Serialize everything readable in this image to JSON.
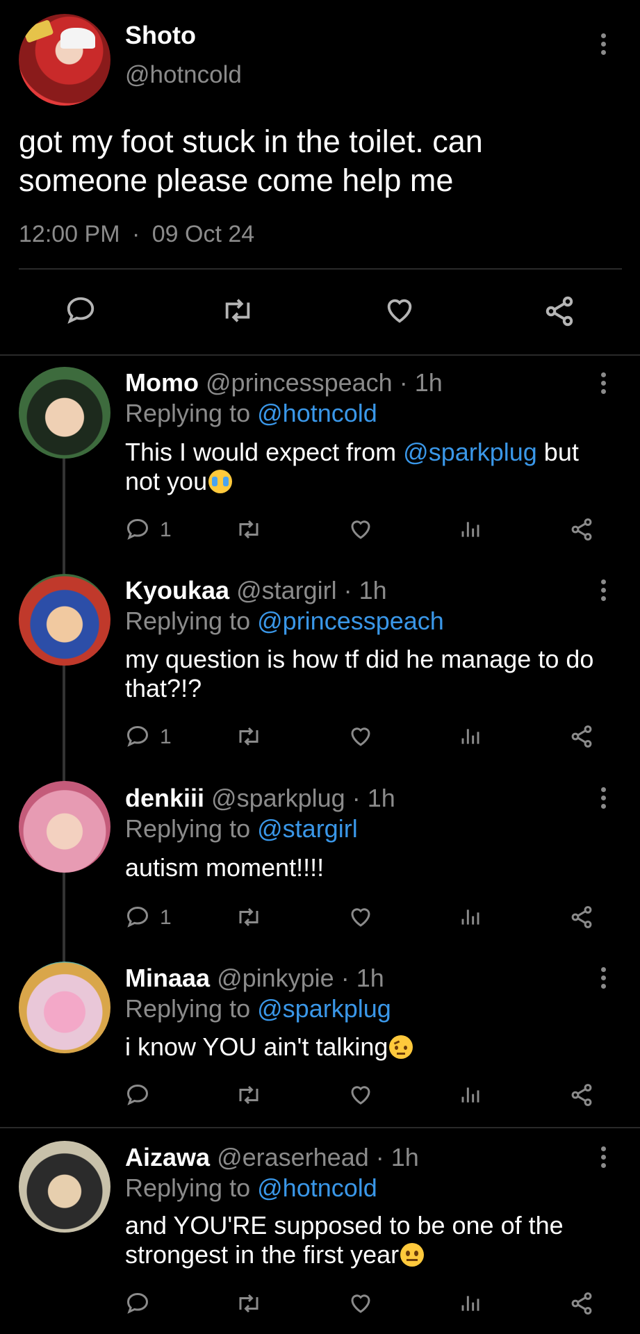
{
  "tweet": {
    "name": "Shoto",
    "handle": "@hotncold",
    "text_line1": "got my foot stuck in the toilet. can",
    "text_line2": "someone please come help me",
    "time": "12:00 PM",
    "dot": "·",
    "date": "09 Oct 24"
  },
  "replies": [
    {
      "name": "Momo",
      "handle": "@princesspeach",
      "age": "· 1h",
      "replying_prefix": "Replying to",
      "replying_to": "@hotncold",
      "text_a": "This I would expect from ",
      "mention": "@sparkplug",
      "text_b": " but",
      "text_line2": "not you",
      "emoji": "😭",
      "reply_count": "1"
    },
    {
      "name": "Kyoukaa",
      "handle": "@stargirl",
      "age": "· 1h",
      "replying_prefix": "Replying to",
      "replying_to": "@princesspeach",
      "text_line1": "my question is how tf did he manage to do",
      "text_line2": "that?!?",
      "reply_count": "1"
    },
    {
      "name": "denkiii",
      "handle": "@sparkplug",
      "age": "· 1h",
      "replying_prefix": "Replying to",
      "replying_to": "@stargirl",
      "text_line1": "autism moment!!!!",
      "reply_count": "1"
    },
    {
      "name": "Minaaa",
      "handle": "@pinkypie",
      "age": "· 1h",
      "replying_prefix": "Replying to",
      "replying_to": "@sparkplug",
      "text_line1": "i know YOU ain't talking",
      "emoji": "🤨"
    },
    {
      "name": "Aizawa",
      "handle": "@eraserhead",
      "age": "· 1h",
      "replying_prefix": "Replying to",
      "replying_to": "@hotncold",
      "text_line1": "and YOU'RE supposed to be one of the",
      "text_line2": "strongest in the first year",
      "emoji": "😐"
    }
  ],
  "colors": {
    "background": "#000000",
    "text": "#ffffff",
    "muted": "#8b8b8b",
    "link": "#3a97e8",
    "divider": "#2a2a2a"
  }
}
